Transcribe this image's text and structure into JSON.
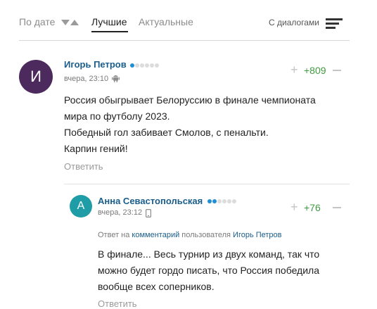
{
  "sort": {
    "by_date": "По дате",
    "best": "Лучшие",
    "actual": "Актуальные",
    "with_dialogs": "С диалогами",
    "active": "Лучшие"
  },
  "colors": {
    "author_link": "#1a5d8a",
    "positive_score": "#3f9a3f",
    "avatar_main": "#4d2a5e",
    "avatar_reply": "#1e9da6",
    "rating_dot_on": "#1e8fd6",
    "rating_dot_off": "#dcdcdc"
  },
  "comments": [
    {
      "avatar_letter": "И",
      "author": "Игорь Петров",
      "rating_dots": {
        "filled": 1,
        "total": 6
      },
      "time": "вчера, 23:10",
      "device_icon": "android-icon",
      "score": "+809",
      "text_lines": [
        "Россия обыгрывает Белоруссию в финале чемпионата",
        "мира по футболу 2023.",
        "Победный гол забивает Смолов, с пенальти.",
        "Карпин гений!"
      ],
      "reply_label": "Ответить",
      "replies": [
        {
          "avatar_letter": "А",
          "author": "Анна Севастопольская",
          "rating_dots": {
            "filled": 2,
            "total": 6
          },
          "time": "вчера, 23:12",
          "device_icon": "phone-icon",
          "score": "+76",
          "reply_to": {
            "prefix": "Ответ на",
            "link1": "комментарий",
            "middle": "пользователя",
            "user": "Игорь Петров"
          },
          "text_lines": [
            "В финале... Весь турнир из двух команд, так что",
            "можно будет гордо писать, что Россия победила",
            "вообще всех соперников."
          ],
          "reply_label": "Ответить"
        }
      ]
    }
  ]
}
